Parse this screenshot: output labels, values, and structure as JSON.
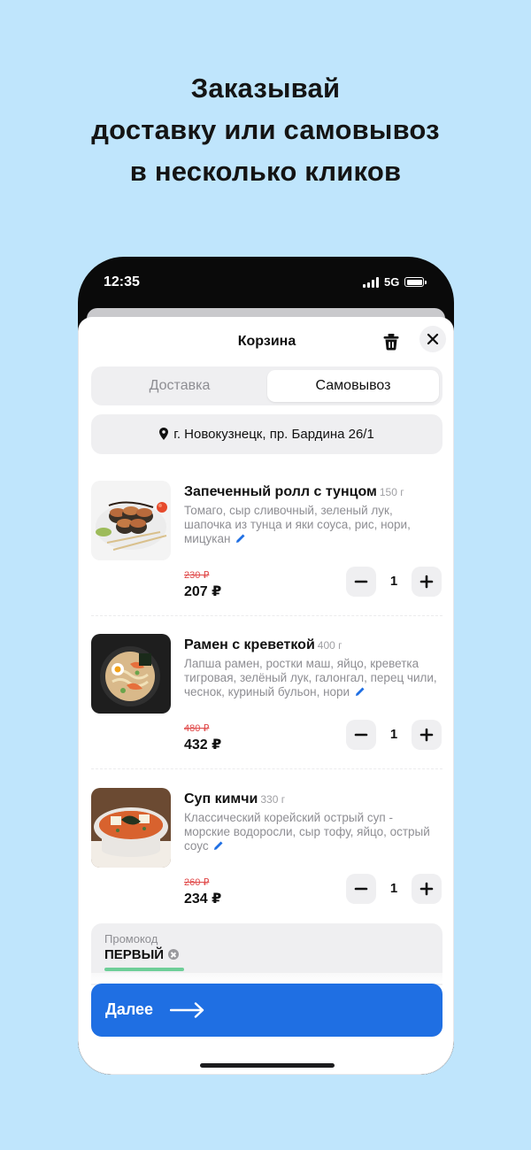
{
  "headline": [
    "Заказывай",
    "доставку или самовывоз",
    "в несколько кликов"
  ],
  "status_bar": {
    "time": "12:35",
    "network": "5G"
  },
  "cart": {
    "title": "Корзина",
    "tabs": [
      {
        "label": "Доставка",
        "selected": false
      },
      {
        "label": "Самовывоз",
        "selected": true
      }
    ],
    "address": "г. Новокузнецк, пр. Бардина 26/1",
    "items": [
      {
        "name": "Запеченный ролл с тунцом",
        "weight": "150 г",
        "description": "Томаго, сыр сливочный, зеленый лук, шапочка из тунца и яки соуса, рис, нори, мицукан",
        "old_price": "230 ₽",
        "price": "207 ₽",
        "quantity": "1"
      },
      {
        "name": "Рамен с креветкой",
        "weight": "400 г",
        "description": "Лапша рамен, ростки маш, яйцо, креветка тигровая, зелёный лук, галонгал, перец чили, чеснок, куриный бульон, нори",
        "old_price": "480 ₽",
        "price": "432 ₽",
        "quantity": "1"
      },
      {
        "name": "Суп кимчи",
        "weight": "330 г",
        "description": "Классический корейский острый суп - морские водоросли, сыр тофу, яйцо, острый соус",
        "old_price": "260 ₽",
        "price": "234 ₽",
        "quantity": "1"
      }
    ],
    "promo": {
      "label": "Промокод",
      "code": "ПЕРВЫЙ"
    },
    "next_button": "Далее"
  },
  "colors": {
    "background": "#bfe5fc",
    "accent": "#1f6fe3",
    "old_price": "#e04848",
    "edit_icon": "#1f6fe3"
  }
}
